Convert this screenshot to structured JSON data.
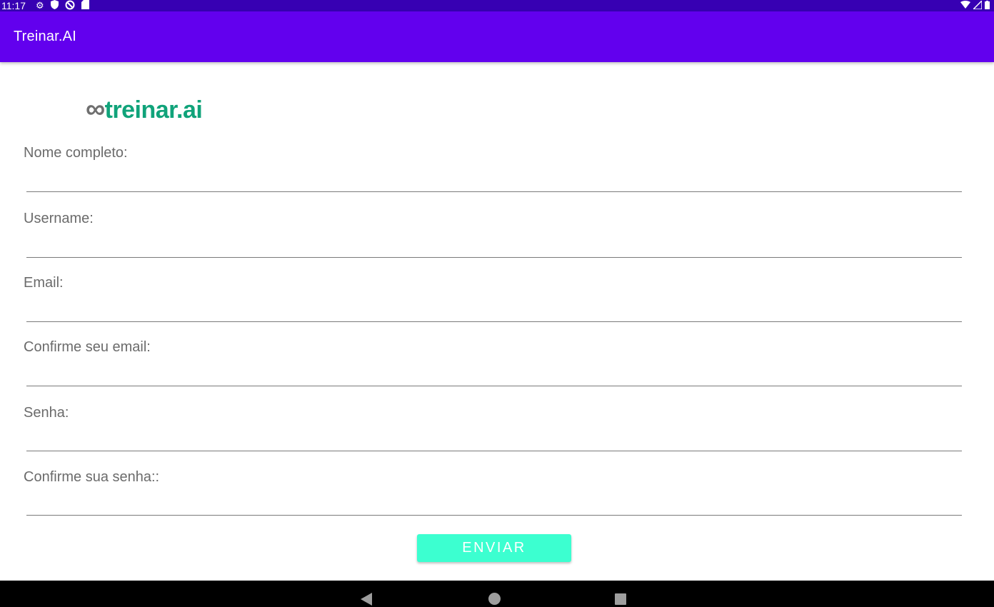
{
  "status_bar": {
    "time": "11:17",
    "left_icons": [
      "gear-icon",
      "shield-icon",
      "no-disturb-icon",
      "sd-card-icon"
    ],
    "right_icons": [
      "wifi-icon",
      "signal-icon",
      "battery-icon"
    ]
  },
  "app_bar": {
    "title": "Treinar.AI",
    "color": "#6200ee"
  },
  "logo": {
    "symbol": "∞",
    "text": "treinar.ai",
    "symbol_color": "#6f6f6f",
    "text_color": "#10a37a"
  },
  "form": {
    "fields": [
      {
        "label": "Nome completo:",
        "value": ""
      },
      {
        "label": "Username:",
        "value": ""
      },
      {
        "label": "Email:",
        "value": ""
      },
      {
        "label": "Confirme seu email:",
        "value": ""
      },
      {
        "label": "Senha:",
        "value": ""
      },
      {
        "label": "Confirme sua senha::",
        "value": ""
      }
    ],
    "submit_label": "ENVIAR",
    "submit_color": "#3cffd0"
  },
  "nav_bar": {
    "buttons": [
      "back-icon",
      "home-icon",
      "recents-icon"
    ]
  }
}
